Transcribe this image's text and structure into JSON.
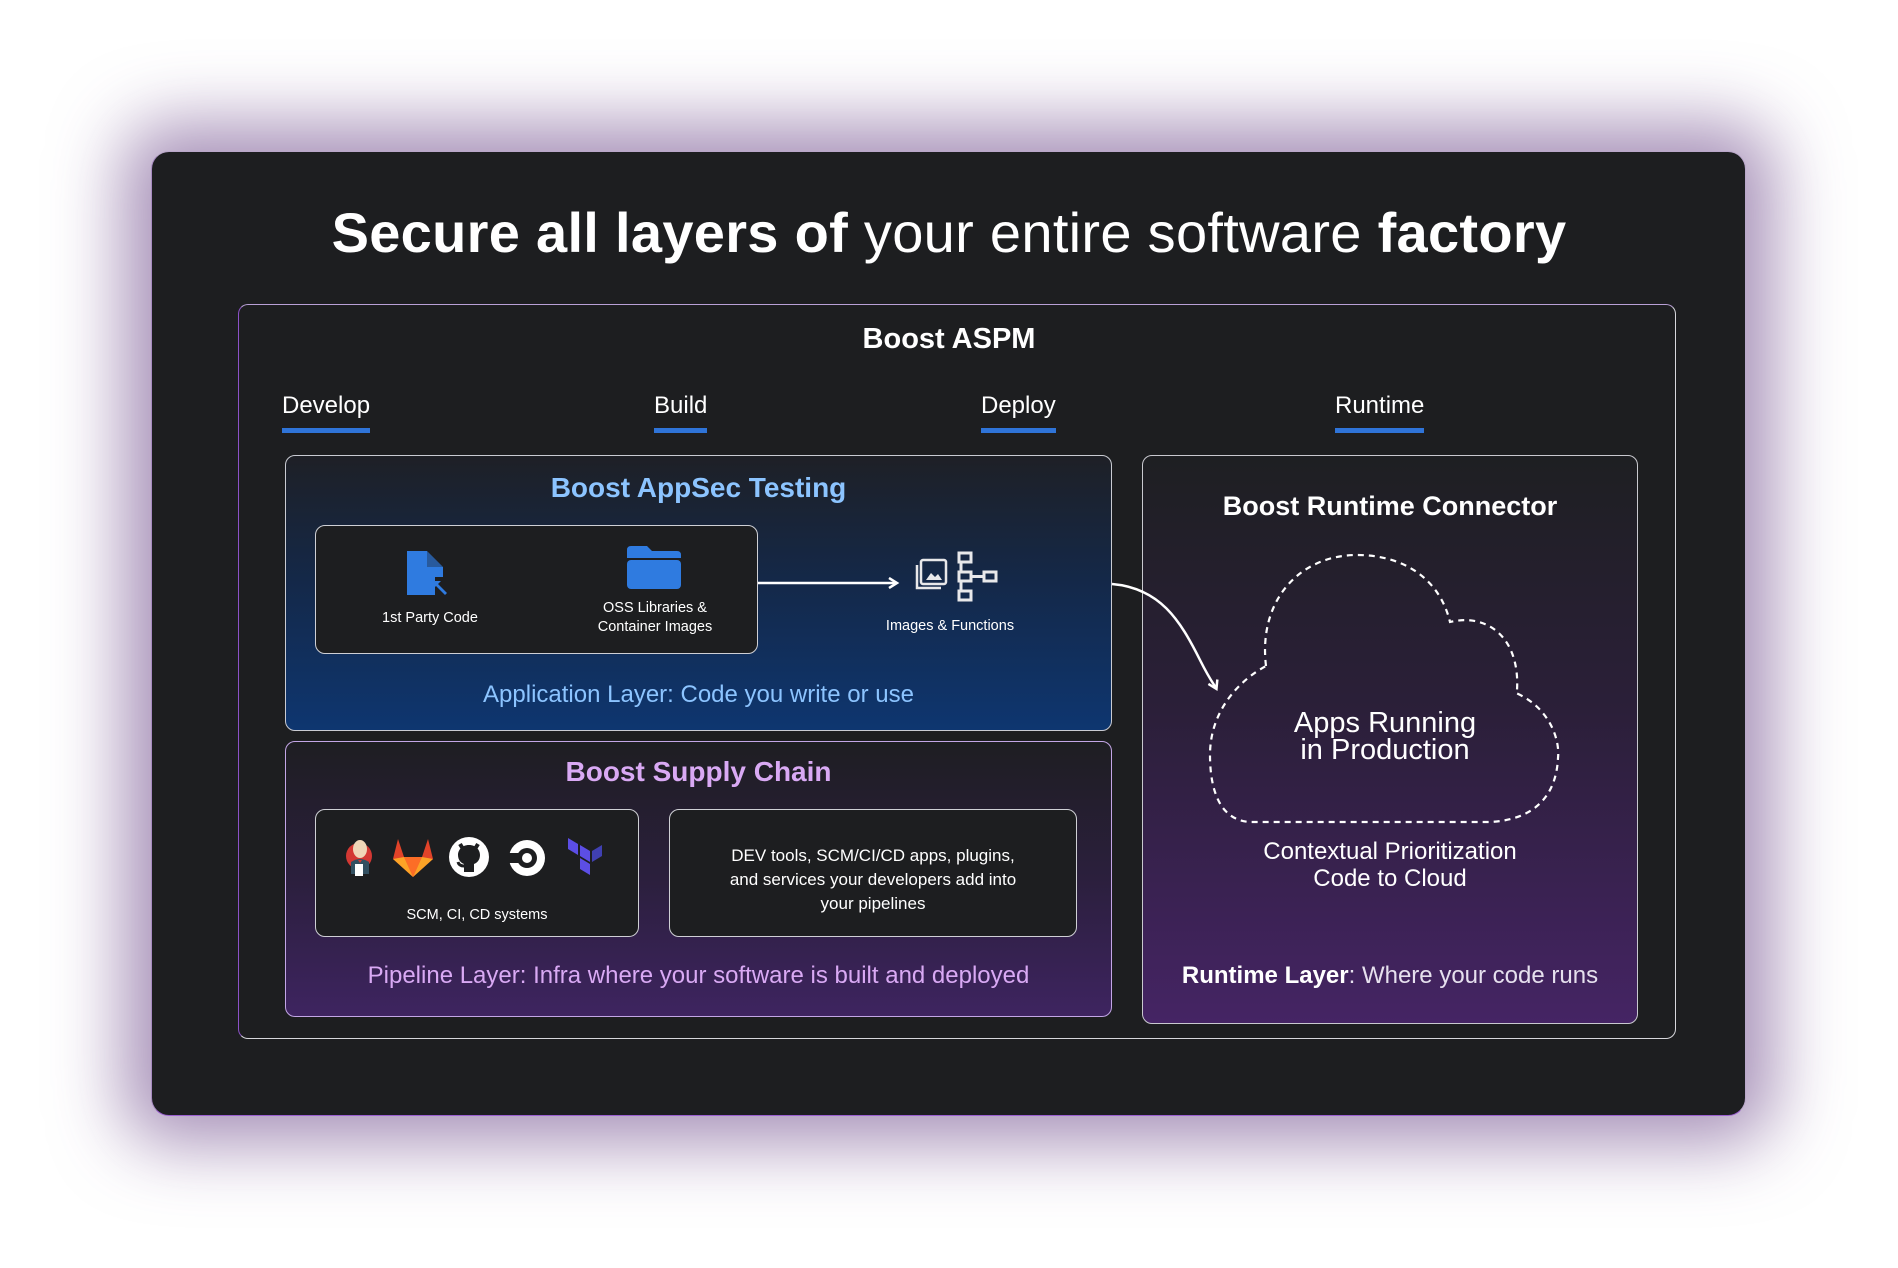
{
  "title": {
    "part1_bold": "Secure all layers of",
    "part2_light": " your entire software ",
    "part3_bold": "factory"
  },
  "aspm": {
    "title": "Boost ASPM",
    "phases": [
      "Develop",
      "Build",
      "Deploy",
      "Runtime"
    ]
  },
  "appsec": {
    "title": "Boost AppSec Testing",
    "first_party_label": "1st Party Code",
    "oss_label_line1": "OSS Libraries &",
    "oss_label_line2": "Container Images",
    "images_functions_label": "Images & Functions",
    "caption": "Application Layer: Code you write or use"
  },
  "supply_chain": {
    "title": "Boost Supply Chain",
    "systems_label": "SCM, CI, CD systems",
    "logos": [
      "jenkins-logo",
      "gitlab-logo",
      "github-logo",
      "circleci-logo",
      "terraform-logo"
    ],
    "devtools_line1": "DEV tools, SCM/CI/CD apps, plugins,",
    "devtools_line2": "and services your developers add into",
    "devtools_line3": "your pipelines",
    "caption": "Pipeline Layer: Infra where your software is built and deployed"
  },
  "runtime": {
    "title": "Boost Runtime Connector",
    "cloud_line1": "Apps Running",
    "cloud_line2": "in Production",
    "context_line1": "Contextual Prioritization",
    "context_line2": "Code to Cloud",
    "caption_bold": "Runtime Layer",
    "caption_light": ": Where your code runs"
  },
  "colors": {
    "accent_blue": "#2f74d8",
    "appsec_title": "#8cc4ff",
    "supply_title": "#d9a9f4",
    "card_bg": "#1d1e20"
  }
}
